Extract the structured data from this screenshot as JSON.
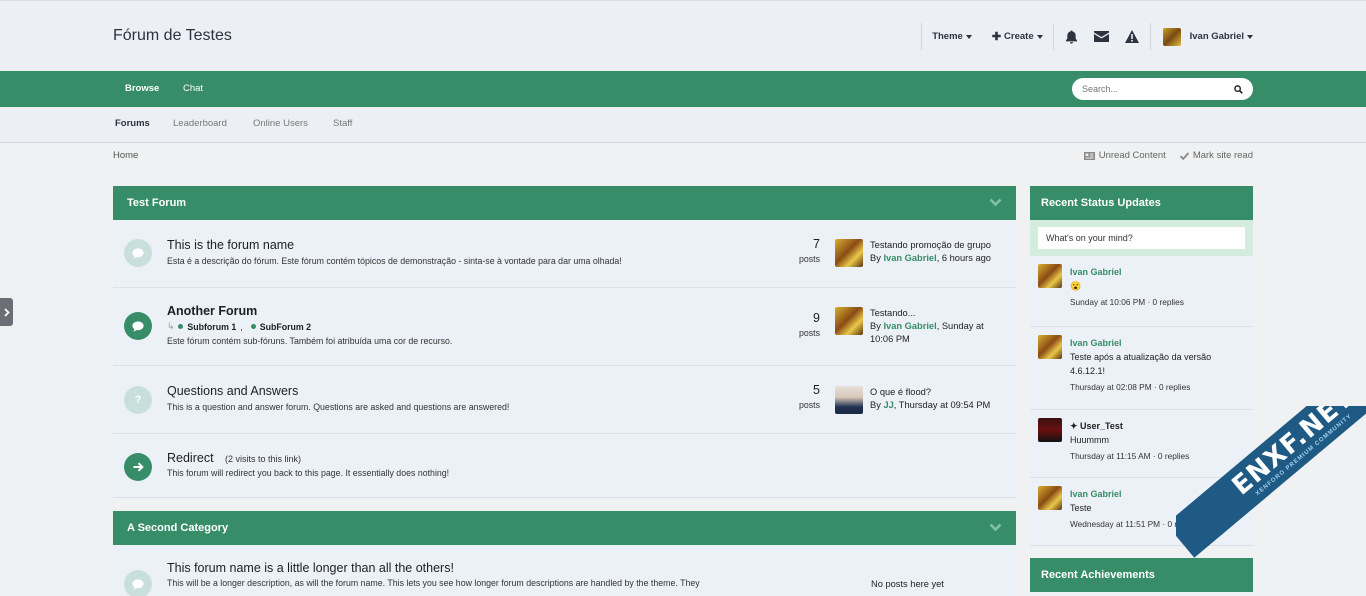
{
  "header": {
    "site_title": "Fórum de Testes",
    "theme_label": "Theme",
    "create_label": "Create",
    "username": "Ivan Gabriel"
  },
  "nav": {
    "tabs": [
      {
        "label": "Browse"
      },
      {
        "label": "Chat"
      }
    ],
    "search_placeholder": "Search..."
  },
  "subnav": {
    "items": [
      {
        "label": "Forums"
      },
      {
        "label": "Leaderboard"
      },
      {
        "label": "Online Users"
      },
      {
        "label": "Staff"
      }
    ]
  },
  "breadcrumb": {
    "home": "Home",
    "unread": "Unread Content",
    "mark_read": "Mark site read"
  },
  "categories": [
    {
      "title": "Test Forum",
      "forums": [
        {
          "name": "This is the forum name",
          "desc": "Esta é a descrição do fórum. Este fórum contém tópicos de demonstração - sinta-se à vontade para dar uma olhada!",
          "count": "7",
          "count_label": "posts",
          "last_title": "Testando promoção de grupo",
          "last_by": "By",
          "last_user": "Ivan Gabriel",
          "last_time": ", 6 hours ago"
        },
        {
          "name": "Another Forum",
          "subforums": [
            "Subforum 1",
            "SubForum 2"
          ],
          "desc": "Este fórum contém sub-fóruns. Também foi atribuída uma cor de recurso.",
          "count": "9",
          "count_label": "posts",
          "last_title": "Testando...",
          "last_by": "By",
          "last_user": "Ivan Gabriel",
          "last_time": ", Sunday at",
          "last_time2": "10:06 PM"
        },
        {
          "name": "Questions and Answers",
          "desc": "This is a question and answer forum. Questions are asked and questions are answered!",
          "count": "5",
          "count_label": "posts",
          "last_title": "O que é flood?",
          "last_by": "By",
          "last_user": "JJ",
          "last_time": ", Thursday at 09:54 PM"
        },
        {
          "name": "Redirect",
          "visits": "(2 visits to this link)",
          "desc": "This forum will redirect you back to this page. It essentially does nothing!"
        }
      ]
    },
    {
      "title": "A Second Category",
      "forums": [
        {
          "name": "This forum name is a little longer than all the others!",
          "desc": "This will be a longer description, as will the forum name. This lets you see how longer forum descriptions are handled by the theme. They",
          "last_title": "No posts here yet"
        }
      ]
    }
  ],
  "sidebar": {
    "status_title": "Recent Status Updates",
    "status_placeholder": "What's on your mind?",
    "statuses": [
      {
        "user": "Ivan Gabriel",
        "text": "😮",
        "meta": "Sunday at 10:06 PM · 0 replies"
      },
      {
        "user": "Ivan Gabriel",
        "text": "Teste após a atualização da versão 4.6.12.1!",
        "meta": "Thursday at 02:08 PM · 0 replies"
      },
      {
        "user": "✦ User_Test",
        "text": "Huummm",
        "meta": "Thursday at 11:15 AM · 0 replies"
      },
      {
        "user": "Ivan Gabriel",
        "text": "Teste",
        "meta": "Wednesday at 11:51 PM · 0 replies"
      }
    ],
    "achievements_title": "Recent Achievements"
  },
  "watermark": {
    "main": "ENXF.NET",
    "sub": "XENFORO PREMIUM COMMUNITY"
  },
  "colors": {
    "accent": "#378d68",
    "header_bg": "#ecf0f5",
    "row_bg": "#ecf1f7"
  }
}
